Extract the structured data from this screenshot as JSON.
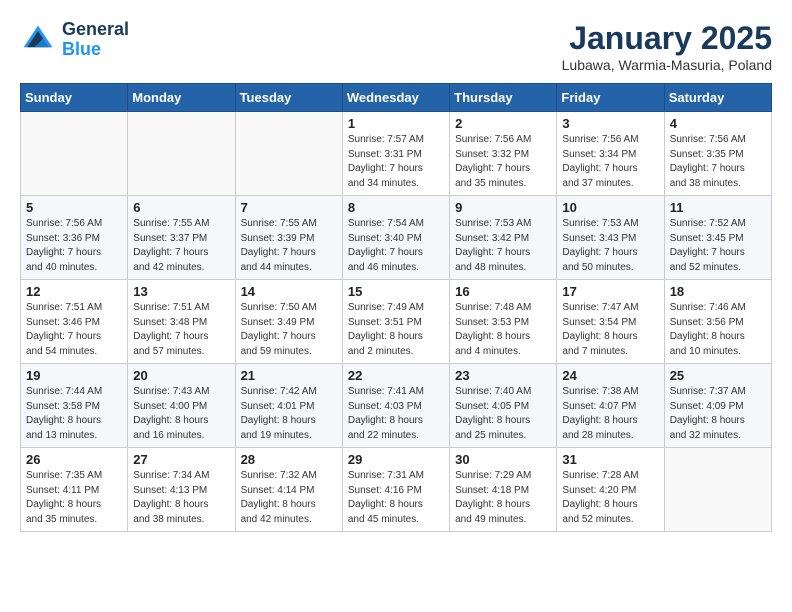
{
  "header": {
    "logo_line1": "General",
    "logo_line2": "Blue",
    "month": "January 2025",
    "location": "Lubawa, Warmia-Masuria, Poland"
  },
  "weekdays": [
    "Sunday",
    "Monday",
    "Tuesday",
    "Wednesday",
    "Thursday",
    "Friday",
    "Saturday"
  ],
  "weeks": [
    [
      {
        "day": "",
        "detail": ""
      },
      {
        "day": "",
        "detail": ""
      },
      {
        "day": "",
        "detail": ""
      },
      {
        "day": "1",
        "detail": "Sunrise: 7:57 AM\nSunset: 3:31 PM\nDaylight: 7 hours\nand 34 minutes."
      },
      {
        "day": "2",
        "detail": "Sunrise: 7:56 AM\nSunset: 3:32 PM\nDaylight: 7 hours\nand 35 minutes."
      },
      {
        "day": "3",
        "detail": "Sunrise: 7:56 AM\nSunset: 3:34 PM\nDaylight: 7 hours\nand 37 minutes."
      },
      {
        "day": "4",
        "detail": "Sunrise: 7:56 AM\nSunset: 3:35 PM\nDaylight: 7 hours\nand 38 minutes."
      }
    ],
    [
      {
        "day": "5",
        "detail": "Sunrise: 7:56 AM\nSunset: 3:36 PM\nDaylight: 7 hours\nand 40 minutes."
      },
      {
        "day": "6",
        "detail": "Sunrise: 7:55 AM\nSunset: 3:37 PM\nDaylight: 7 hours\nand 42 minutes."
      },
      {
        "day": "7",
        "detail": "Sunrise: 7:55 AM\nSunset: 3:39 PM\nDaylight: 7 hours\nand 44 minutes."
      },
      {
        "day": "8",
        "detail": "Sunrise: 7:54 AM\nSunset: 3:40 PM\nDaylight: 7 hours\nand 46 minutes."
      },
      {
        "day": "9",
        "detail": "Sunrise: 7:53 AM\nSunset: 3:42 PM\nDaylight: 7 hours\nand 48 minutes."
      },
      {
        "day": "10",
        "detail": "Sunrise: 7:53 AM\nSunset: 3:43 PM\nDaylight: 7 hours\nand 50 minutes."
      },
      {
        "day": "11",
        "detail": "Sunrise: 7:52 AM\nSunset: 3:45 PM\nDaylight: 7 hours\nand 52 minutes."
      }
    ],
    [
      {
        "day": "12",
        "detail": "Sunrise: 7:51 AM\nSunset: 3:46 PM\nDaylight: 7 hours\nand 54 minutes."
      },
      {
        "day": "13",
        "detail": "Sunrise: 7:51 AM\nSunset: 3:48 PM\nDaylight: 7 hours\nand 57 minutes."
      },
      {
        "day": "14",
        "detail": "Sunrise: 7:50 AM\nSunset: 3:49 PM\nDaylight: 7 hours\nand 59 minutes."
      },
      {
        "day": "15",
        "detail": "Sunrise: 7:49 AM\nSunset: 3:51 PM\nDaylight: 8 hours\nand 2 minutes."
      },
      {
        "day": "16",
        "detail": "Sunrise: 7:48 AM\nSunset: 3:53 PM\nDaylight: 8 hours\nand 4 minutes."
      },
      {
        "day": "17",
        "detail": "Sunrise: 7:47 AM\nSunset: 3:54 PM\nDaylight: 8 hours\nand 7 minutes."
      },
      {
        "day": "18",
        "detail": "Sunrise: 7:46 AM\nSunset: 3:56 PM\nDaylight: 8 hours\nand 10 minutes."
      }
    ],
    [
      {
        "day": "19",
        "detail": "Sunrise: 7:44 AM\nSunset: 3:58 PM\nDaylight: 8 hours\nand 13 minutes."
      },
      {
        "day": "20",
        "detail": "Sunrise: 7:43 AM\nSunset: 4:00 PM\nDaylight: 8 hours\nand 16 minutes."
      },
      {
        "day": "21",
        "detail": "Sunrise: 7:42 AM\nSunset: 4:01 PM\nDaylight: 8 hours\nand 19 minutes."
      },
      {
        "day": "22",
        "detail": "Sunrise: 7:41 AM\nSunset: 4:03 PM\nDaylight: 8 hours\nand 22 minutes."
      },
      {
        "day": "23",
        "detail": "Sunrise: 7:40 AM\nSunset: 4:05 PM\nDaylight: 8 hours\nand 25 minutes."
      },
      {
        "day": "24",
        "detail": "Sunrise: 7:38 AM\nSunset: 4:07 PM\nDaylight: 8 hours\nand 28 minutes."
      },
      {
        "day": "25",
        "detail": "Sunrise: 7:37 AM\nSunset: 4:09 PM\nDaylight: 8 hours\nand 32 minutes."
      }
    ],
    [
      {
        "day": "26",
        "detail": "Sunrise: 7:35 AM\nSunset: 4:11 PM\nDaylight: 8 hours\nand 35 minutes."
      },
      {
        "day": "27",
        "detail": "Sunrise: 7:34 AM\nSunset: 4:13 PM\nDaylight: 8 hours\nand 38 minutes."
      },
      {
        "day": "28",
        "detail": "Sunrise: 7:32 AM\nSunset: 4:14 PM\nDaylight: 8 hours\nand 42 minutes."
      },
      {
        "day": "29",
        "detail": "Sunrise: 7:31 AM\nSunset: 4:16 PM\nDaylight: 8 hours\nand 45 minutes."
      },
      {
        "day": "30",
        "detail": "Sunrise: 7:29 AM\nSunset: 4:18 PM\nDaylight: 8 hours\nand 49 minutes."
      },
      {
        "day": "31",
        "detail": "Sunrise: 7:28 AM\nSunset: 4:20 PM\nDaylight: 8 hours\nand 52 minutes."
      },
      {
        "day": "",
        "detail": ""
      }
    ]
  ]
}
